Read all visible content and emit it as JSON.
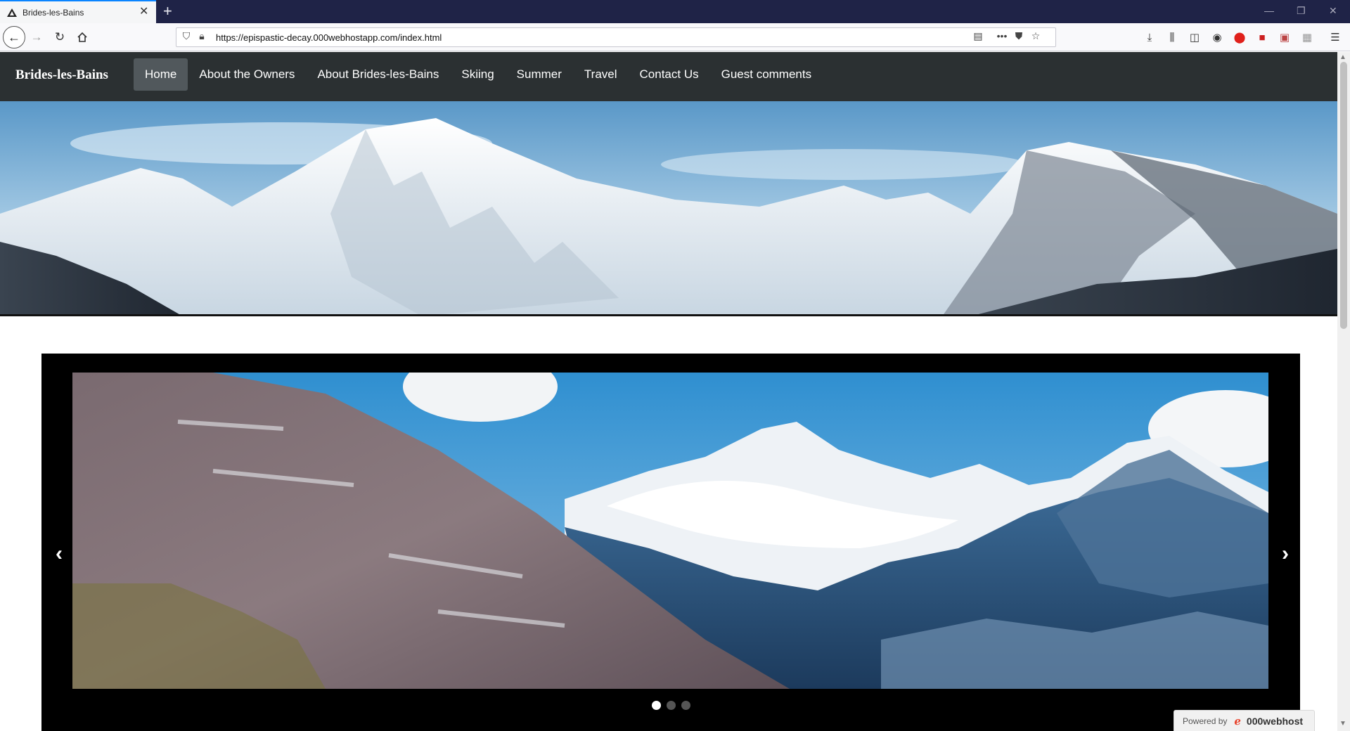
{
  "browser": {
    "tab_title": "Brides-les-Bains",
    "tab_close": "✕",
    "new_tab": "+",
    "url": "https://epispastic-decay.000webhostapp.com/index.html",
    "window_minimize": "—",
    "window_restore": "❐",
    "window_close": "✕"
  },
  "site": {
    "brand": "Brides-les-Bains",
    "menu": [
      {
        "label": "Home",
        "active": true
      },
      {
        "label": "About the Owners"
      },
      {
        "label": "About Brides-les-Bains"
      },
      {
        "label": "Skiing"
      },
      {
        "label": "Summer"
      },
      {
        "label": "Travel"
      },
      {
        "label": "Contact Us"
      },
      {
        "label": "Guest comments"
      }
    ]
  },
  "carousel": {
    "prev": "‹",
    "next": "›",
    "slide_count": 3,
    "active_index": 0
  },
  "powered": {
    "label": "Powered by",
    "brand": "000webhost"
  },
  "colors": {
    "nav_bg": "#2b3032",
    "active_item": "#51585c",
    "carousel_bg": "#000000"
  }
}
